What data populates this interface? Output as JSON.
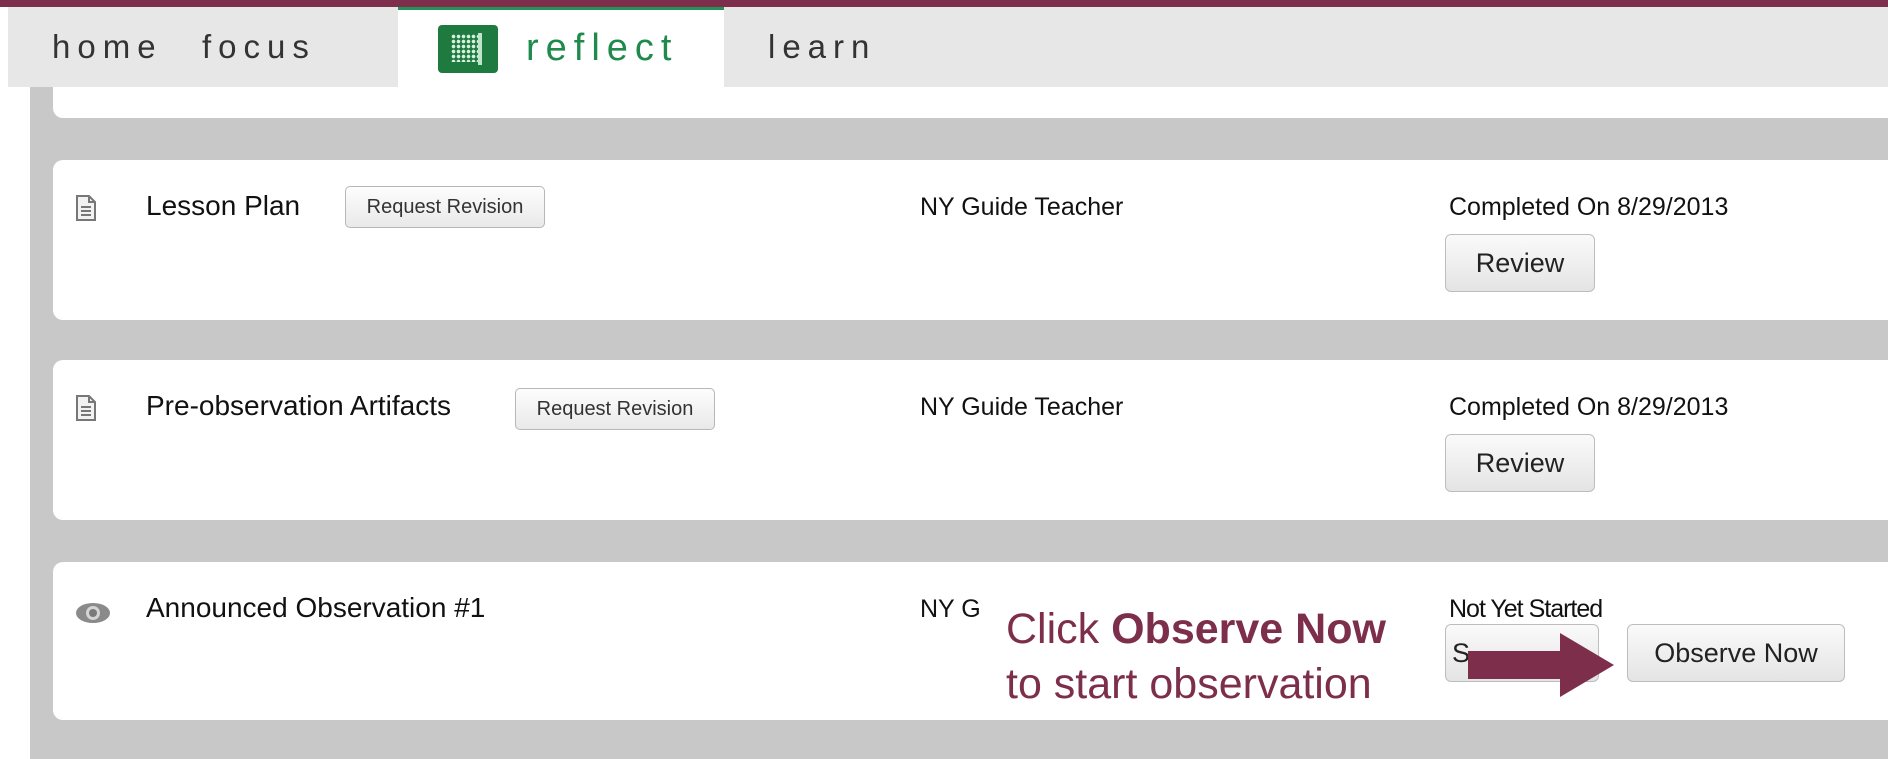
{
  "nav": {
    "tabs": [
      {
        "label": "home"
      },
      {
        "label": "focus"
      },
      {
        "label": "reflect",
        "active": true
      },
      {
        "label": "learn"
      }
    ]
  },
  "items": [
    {
      "icon": "document-icon",
      "title": "Lesson Plan",
      "action_label": "Request Revision",
      "assignee": "NY Guide Teacher",
      "status": "Completed On 8/29/2013",
      "button_label": "Review"
    },
    {
      "icon": "document-icon",
      "title": "Pre-observation Artifacts",
      "action_label": "Request Revision",
      "assignee": "NY Guide Teacher",
      "status": "Completed On 8/29/2013",
      "button_label": "Review"
    },
    {
      "icon": "eye-icon",
      "title": "Announced Observation #1",
      "assignee": "NY G",
      "status": "Not Yet Started",
      "secondary_button_label": "S",
      "button_label": "Observe Now"
    }
  ],
  "callout": {
    "prefix": "Click ",
    "emphasis": "Observe Now",
    "line2": "to start observation"
  },
  "colors": {
    "accent": "#7d2e4a",
    "brand_green": "#1f8a4c"
  }
}
